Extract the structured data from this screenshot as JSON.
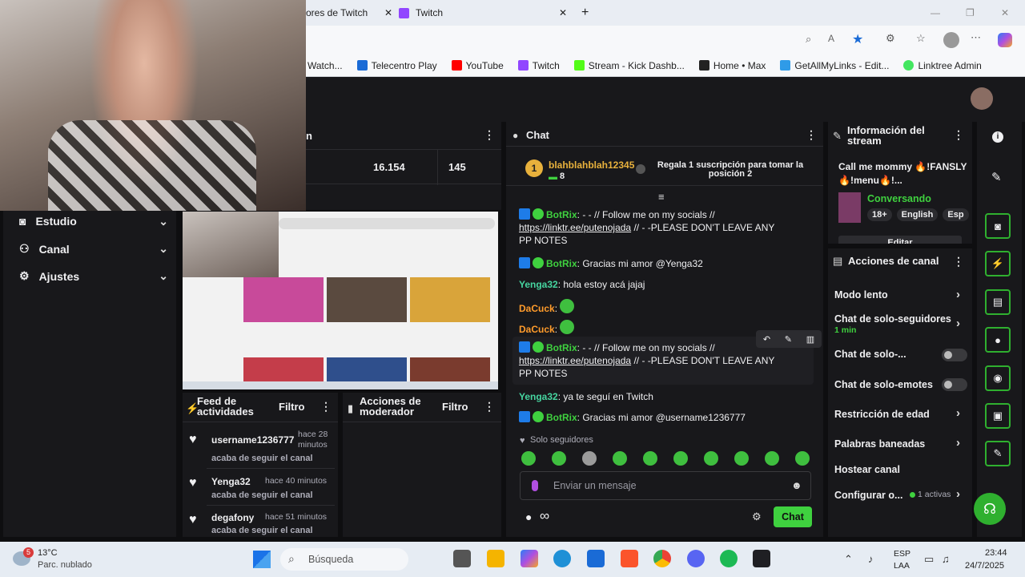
{
  "browser": {
    "tabs": [
      {
        "label": "ores de Twitch"
      },
      {
        "label": "Twitch"
      }
    ],
    "bookmarks": [
      {
        "label": "Watch...",
        "color": "#e6e6e6"
      },
      {
        "label": "Telecentro Play",
        "color": "#1a6bd6"
      },
      {
        "label": "YouTube",
        "color": "#ff0000"
      },
      {
        "label": "Twitch",
        "color": "#9146ff"
      },
      {
        "label": "Stream - Kick Dashb...",
        "color": "#53fc18"
      },
      {
        "label": "Home • Max",
        "color": "#222222"
      },
      {
        "label": "GetAllMyLinks - Edit...",
        "color": "#2f9be8"
      },
      {
        "label": "Linktree Admin",
        "color": "#43e660"
      }
    ]
  },
  "stats": {
    "header_fragment": "n",
    "viewers": "16.154",
    "followers": "145"
  },
  "nav": {
    "items": [
      {
        "label": "Estudio"
      },
      {
        "label": "Canal"
      },
      {
        "label": "Ajustes"
      }
    ]
  },
  "activity_feed": {
    "title": "Feed de actividades",
    "filter_label": "Filtro",
    "items": [
      {
        "user": "username1236777",
        "time": "hace 28 minutos",
        "action": "acaba de seguir el canal"
      },
      {
        "user": "Yenga32",
        "time": "hace 40 minutos",
        "action": "acaba de seguir el canal"
      },
      {
        "user": "degafony",
        "time": "hace 51 minutos",
        "action": "acaba de seguir el canal"
      }
    ]
  },
  "mod_actions": {
    "title": "Acciones de moderador",
    "filter_label": "Filtro"
  },
  "chat": {
    "title": "Chat",
    "gift": {
      "rank": "1",
      "user": "blahblahblah12345",
      "count": "8",
      "cta": "Regala 1 suscripción para tomar la posición 2"
    },
    "messages": [
      {
        "user": "BotRix",
        "color": "#3fd13f",
        "text": "- - // Follow me on my socials //",
        "link": "https://linktr.ee/putenojada",
        "tail": "// - -PLEASE DON'T LEAVE ANY PP NOTES"
      },
      {
        "user": "BotRix",
        "color": "#3fd13f",
        "text": "Gracias mi amor @Yenga32"
      },
      {
        "user": "Yenga32",
        "color": "#46d5a0",
        "text": "hola estoy acá jajaj"
      },
      {
        "user": "DaCuck",
        "color": "#ff9b2b",
        "text": ""
      },
      {
        "user": "DaCuck",
        "color": "#ff9b2b",
        "text": ""
      },
      {
        "user": "BotRix",
        "color": "#3fd13f",
        "text": "- - // Follow me on my socials //",
        "link": "https://linktr.ee/putenojada",
        "tail": "// - -PLEASE DON'T LEAVE ANY PP NOTES"
      },
      {
        "user": "Yenga32",
        "color": "#46d5a0",
        "text": "ya te seguí en Twitch"
      },
      {
        "user": "BotRix",
        "color": "#3fd13f",
        "text": "Gracias mi amor @username1236777"
      }
    ],
    "followers_only": "Solo seguidores",
    "input_placeholder": "Enviar un mensaje",
    "send_label": "Chat",
    "infinity": "∞"
  },
  "stream_info": {
    "title": "Información del stream",
    "stream_title": "Call me mommy 🔥!FANSLY🔥!menu🔥!...",
    "category": "Conversando",
    "tags": [
      "18+",
      "English",
      "Esp"
    ],
    "edit_label": "Editar"
  },
  "channel_actions": {
    "title": "Acciones de canal",
    "items": [
      {
        "label": "Modo lento"
      },
      {
        "label": "Chat de solo-seguidores",
        "sub": "1 min"
      },
      {
        "label": "Chat de solo-..."
      },
      {
        "label": "Chat de solo-emotes"
      },
      {
        "label": "Restricción de edad"
      },
      {
        "label": "Palabras baneadas"
      },
      {
        "label": "Hostear canal"
      },
      {
        "label": "Configurar o...",
        "badge": "1 activas"
      }
    ]
  },
  "taskbar": {
    "weather_temp": "13°C",
    "weather_desc": "Parc. nublado",
    "search_placeholder": "Búsqueda",
    "lang": "ESP",
    "lang_region": "LAA",
    "time": "23:44",
    "date": "24/7/2025",
    "weather_badge": "5"
  }
}
